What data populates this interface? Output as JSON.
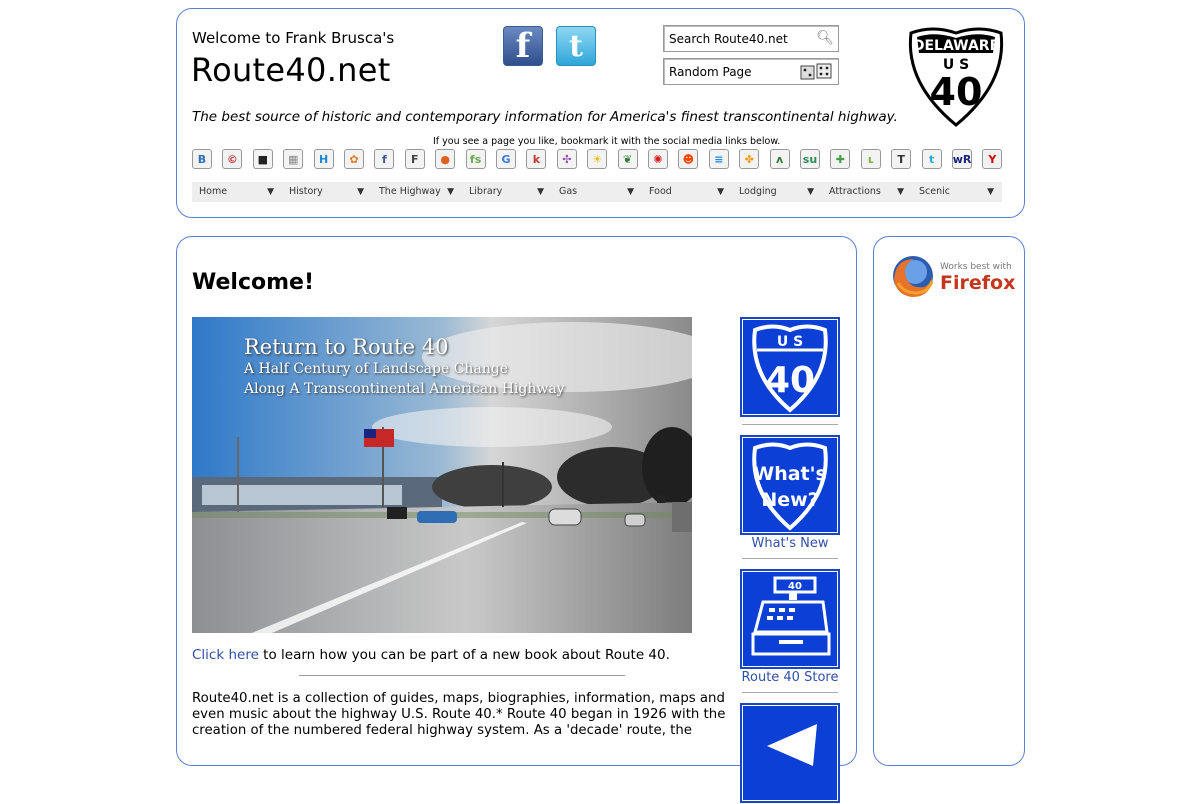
{
  "header": {
    "welcome": "Welcome to Frank Brusca's",
    "site_title": "Route40.net",
    "tagline": "The best source of historic and contemporary information for America's finest transcontinental highway.",
    "search_placeholder": "Search Route40.net",
    "random_page": "Random Page",
    "shield": {
      "state": "DELAWARE",
      "us": "U S",
      "number": "40"
    },
    "bookmark_note": "If you see a page you like, bookmark it with the social media links below.",
    "social_big": [
      "f",
      "t"
    ],
    "bookmark_icons": [
      {
        "glyph": "B",
        "color": "#2f6fb5"
      },
      {
        "glyph": "©",
        "color": "#d23b3b"
      },
      {
        "glyph": "■",
        "color": "#222222"
      },
      {
        "glyph": "▦",
        "color": "#888888"
      },
      {
        "glyph": "H",
        "color": "#1f87d6"
      },
      {
        "glyph": "✿",
        "color": "#e07a20"
      },
      {
        "glyph": "f",
        "color": "#3b5998"
      },
      {
        "glyph": "F",
        "color": "#444444"
      },
      {
        "glyph": "●",
        "color": "#e06020"
      },
      {
        "glyph": "fs",
        "color": "#6aa84f"
      },
      {
        "glyph": "G",
        "color": "#3a78d8"
      },
      {
        "glyph": "k",
        "color": "#c0392b"
      },
      {
        "glyph": "✣",
        "color": "#8e44ad"
      },
      {
        "glyph": "☀",
        "color": "#e6b800"
      },
      {
        "glyph": "❦",
        "color": "#2e7d32"
      },
      {
        "glyph": "✺",
        "color": "#d62020"
      },
      {
        "glyph": "☻",
        "color": "#ff4500"
      },
      {
        "glyph": "≡",
        "color": "#1e88e5"
      },
      {
        "glyph": "✤",
        "color": "#f39c12"
      },
      {
        "glyph": "ʌ",
        "color": "#2c7a2c"
      },
      {
        "glyph": "su",
        "color": "#2e8b57"
      },
      {
        "glyph": "✚",
        "color": "#43a047"
      },
      {
        "glyph": "ʟ",
        "color": "#7cb342"
      },
      {
        "glyph": "T",
        "color": "#333333"
      },
      {
        "glyph": "t",
        "color": "#29a9e1"
      },
      {
        "glyph": "wR",
        "color": "#1a237e"
      },
      {
        "glyph": "Y",
        "color": "#d50000"
      }
    ]
  },
  "nav": [
    {
      "label": "Home"
    },
    {
      "label": "History"
    },
    {
      "label": "The Highway"
    },
    {
      "label": "Library"
    },
    {
      "label": "Gas"
    },
    {
      "label": "Food"
    },
    {
      "label": "Lodging"
    },
    {
      "label": "Attractions"
    },
    {
      "label": "Scenic"
    }
  ],
  "main": {
    "heading": "Welcome!",
    "hero": {
      "title": "Return to Route 40",
      "line2": "A Half Century of Landscape Change",
      "line3": "Along A Transcontinental American Highway"
    },
    "click_link": "Click here",
    "click_rest": " to learn how you can be part of a new book about Route 40.",
    "paragraph": "Route40.net is a collection of guides, maps, biographies, information, maps and even music about the highway U.S. Route 40.* Route 40 began in 1926 with the creation of the numbered federal highway system. As a 'decade' route, the"
  },
  "side_tiles": [
    {
      "label": "",
      "text": "U S 40"
    },
    {
      "label": "What's New",
      "text": "What's New?"
    },
    {
      "label": "Route 40 Store",
      "text": ""
    }
  ],
  "sidebar": {
    "small": "Works best with",
    "big": "Firefox"
  }
}
